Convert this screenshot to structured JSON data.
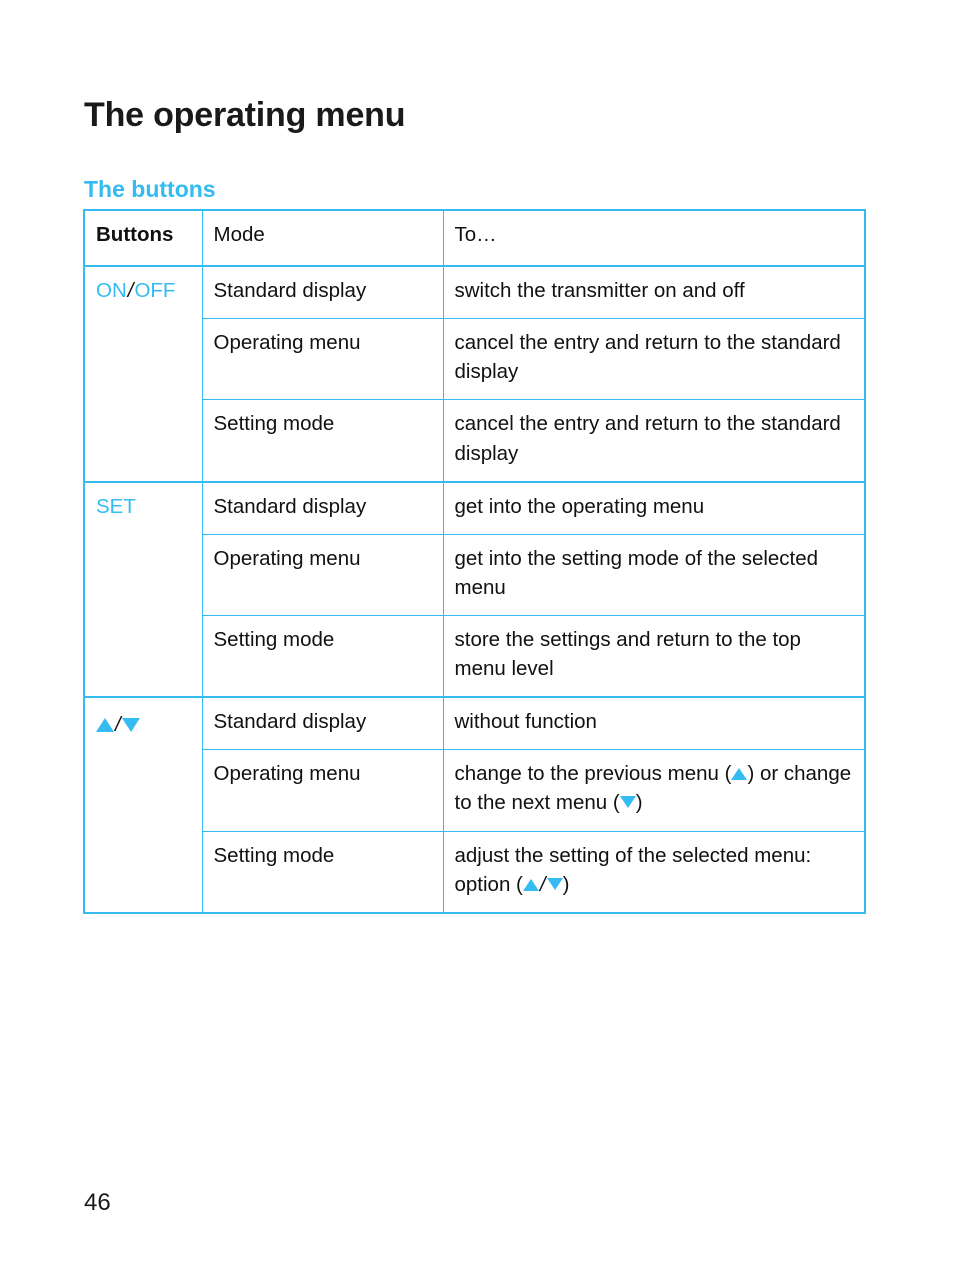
{
  "document": {
    "title": "The operating menu",
    "section_heading": "The buttons",
    "page_number": "46",
    "accent_color": "#33bbf2",
    "text_color": "#111111"
  },
  "table": {
    "headers": {
      "buttons": "Buttons",
      "mode": "Mode",
      "to": "To…"
    },
    "groups": [
      {
        "button_label_parts": [
          {
            "text": "ON",
            "color": "accent"
          },
          {
            "text": "/",
            "color": "black"
          },
          {
            "text": "OFF",
            "color": "accent"
          }
        ],
        "button_label_plain": "ON/OFF",
        "rows": [
          {
            "mode": "Standard display",
            "to": "switch the transmitter on and off"
          },
          {
            "mode": "Operating menu",
            "to": "cancel the entry and return to the standard display"
          },
          {
            "mode": "Setting mode",
            "to": "cancel the entry and return to the standard display"
          }
        ]
      },
      {
        "button_label_parts": [
          {
            "text": "SET",
            "color": "accent"
          }
        ],
        "button_label_plain": "SET",
        "rows": [
          {
            "mode": "Standard display",
            "to": "get into the operating menu"
          },
          {
            "mode": "Operating menu",
            "to": "get into the setting mode of the selected menu"
          },
          {
            "mode": "Setting mode",
            "to": "store the settings and return to the top menu level"
          }
        ]
      },
      {
        "button_label_parts": [
          {
            "text": "▲",
            "color": "accent"
          },
          {
            "text": "/",
            "color": "black"
          },
          {
            "text": "▼",
            "color": "accent"
          }
        ],
        "button_label_plain": "▲/▼",
        "rows": [
          {
            "mode": "Standard display",
            "to": "without function"
          },
          {
            "mode": "Operating menu",
            "to": "change to the previous menu (▲) or change to the next menu (▼)"
          },
          {
            "mode": "Setting mode",
            "to": "adjust the setting of the selected menu:\noption (▲/▼)"
          }
        ]
      }
    ]
  },
  "icons": {
    "triangle_up": "up-triangle-icon",
    "triangle_down": "down-triangle-icon"
  }
}
